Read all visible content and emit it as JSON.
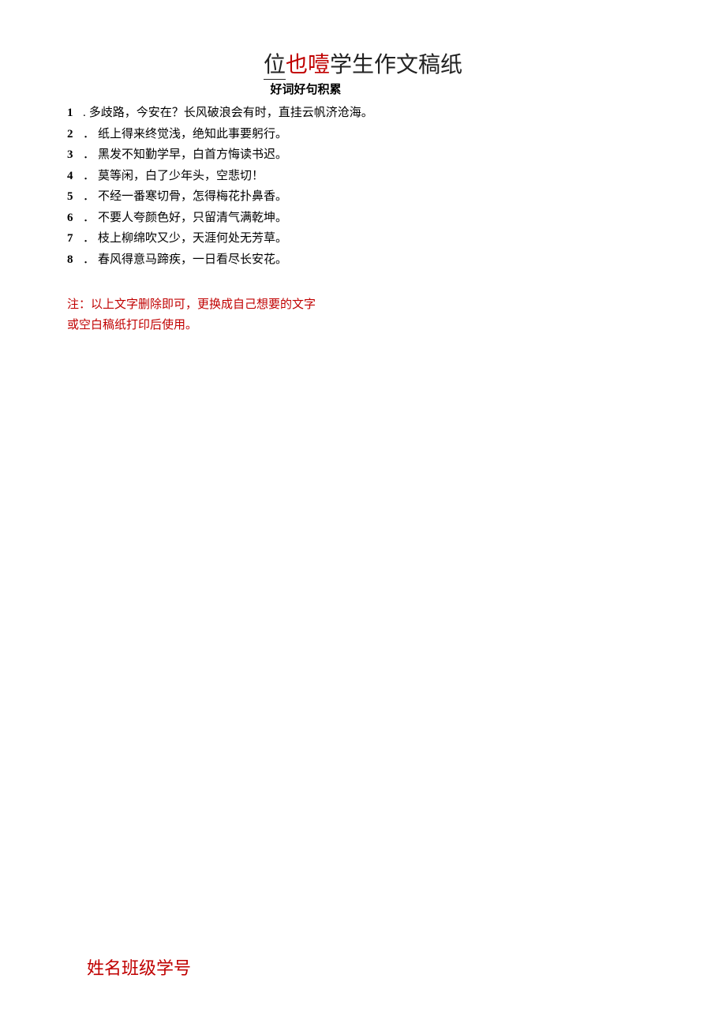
{
  "title": {
    "part1": "位",
    "part2": "也噎",
    "part3": "学生作文稿纸"
  },
  "subtitle": "好词好句积累",
  "items": [
    {
      "num": "1",
      "text": "多歧路，今安在？长风破浪会有时，直挂云帆济沧海。"
    },
    {
      "num": "2",
      "text": "纸上得来终觉浅，绝知此事要躬行。"
    },
    {
      "num": "3",
      "text": "黑发不知勤学早，白首方悔读书迟。"
    },
    {
      "num": "4",
      "text": "莫等闲，白了少年头，空悲切！"
    },
    {
      "num": "5",
      "text": "不经一番寒切骨，怎得梅花扑鼻香。"
    },
    {
      "num": "6",
      "text": "不要人夸颜色好，只留清气满乾坤。"
    },
    {
      "num": "7",
      "text": "枝上柳绵吹又少，天涯何处无芳草。"
    },
    {
      "num": "8",
      "text": "春风得意马蹄疾，一日看尽长安花。"
    }
  ],
  "note": "注：以上文字删除即可，更换成自己想要的文字或空白稿纸打印后使用。",
  "footer": "姓名班级学号"
}
